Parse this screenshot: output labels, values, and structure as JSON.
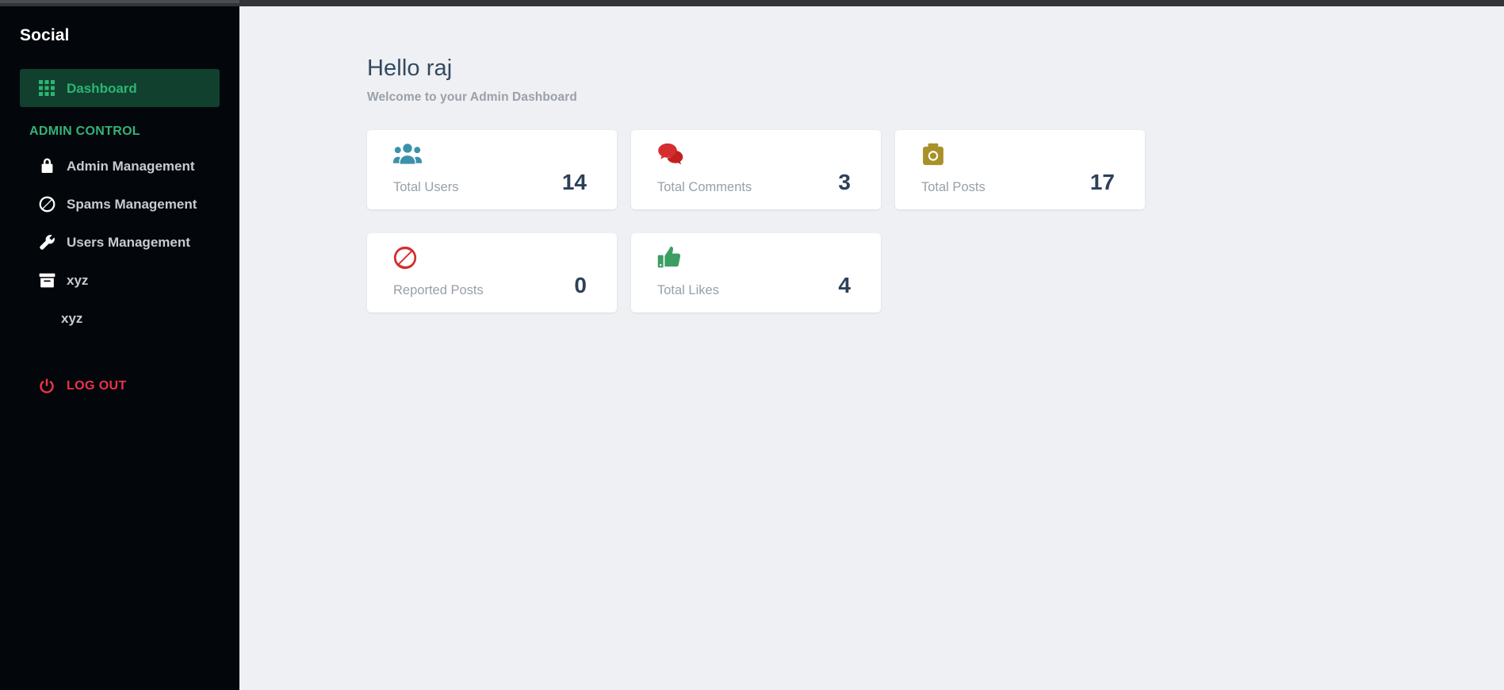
{
  "app": {
    "brand": "Social",
    "accent_green": "#2bb673",
    "accent_red": "#f0324b",
    "sidebar_bg": "#03060a",
    "content_bg": "#eef0f4"
  },
  "sidebar": {
    "section_label": "ADMIN CONTROL",
    "items": [
      {
        "label": "Dashboard",
        "icon": "grid-icon",
        "active": true
      },
      {
        "label": "Admin Management",
        "icon": "lock-icon",
        "active": false
      },
      {
        "label": "Spams Management",
        "icon": "ban-icon",
        "active": false
      },
      {
        "label": "Users Management",
        "icon": "wrench-icon",
        "active": false
      },
      {
        "label": "xyz",
        "icon": "archive-icon",
        "active": false
      },
      {
        "label": "xyz",
        "icon": "none",
        "active": false
      }
    ],
    "logout": {
      "label": "LOG OUT",
      "icon": "power-icon"
    }
  },
  "main": {
    "title": "Hello raj",
    "subtitle": "Welcome to your Admin Dashboard",
    "cards": [
      {
        "label": "Total Users",
        "value": "14",
        "icon": "users-icon",
        "color": "#3b91ab"
      },
      {
        "label": "Total Comments",
        "value": "3",
        "icon": "comments-icon",
        "color": "#d42e2e"
      },
      {
        "label": "Total Posts",
        "value": "17",
        "icon": "camera-icon",
        "color": "#a8912a"
      },
      {
        "label": "Reported Posts",
        "value": "0",
        "icon": "ban-icon",
        "color": "#d42e2e"
      },
      {
        "label": "Total Likes",
        "value": "4",
        "icon": "thumbs-up-icon",
        "color": "#3d9e63"
      }
    ]
  }
}
